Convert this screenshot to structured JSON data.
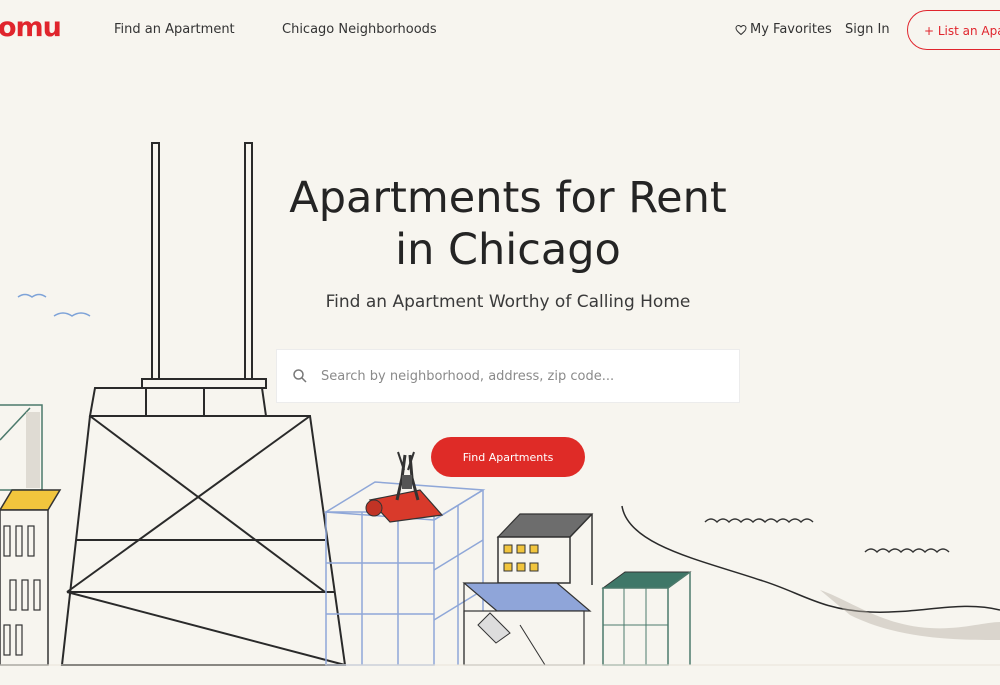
{
  "nav": {
    "logo": "omu",
    "links": [
      "Find an Apartment",
      "Chicago Neighborhoods"
    ],
    "favorites": "My Favorites",
    "sign_in": "Sign In",
    "list_button": "+ List an Apartment"
  },
  "hero": {
    "title_line1": "Apartments for Rent",
    "title_line2": "in Chicago",
    "subtitle": "Find an Apartment Worthy of Calling Home",
    "search_placeholder": "Search by neighborhood, address, zip code...",
    "search_value": "",
    "cta": "Find Apartments"
  },
  "colors": {
    "brand": "#e0252d",
    "background": "#f7f5ef"
  },
  "icons": {
    "search": "search-icon",
    "favorites": "heart-icon"
  }
}
